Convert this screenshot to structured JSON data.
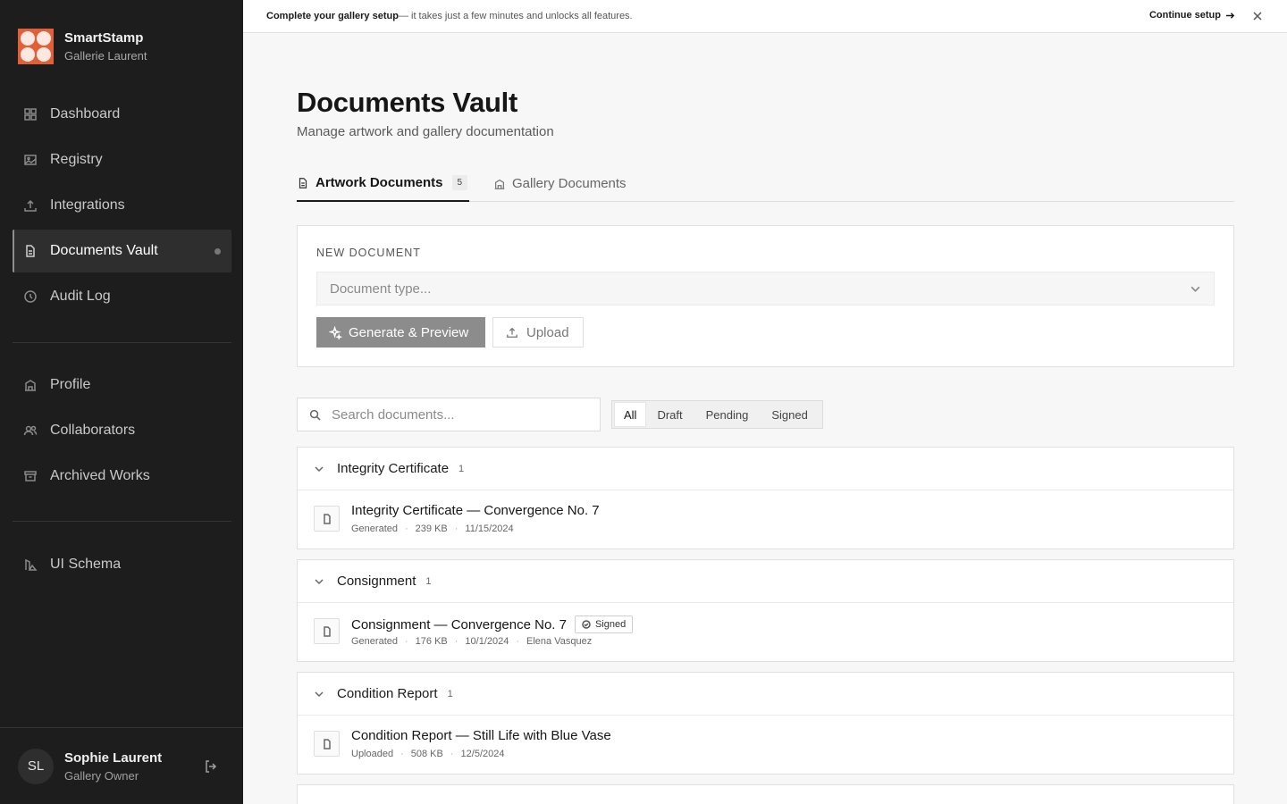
{
  "brand": {
    "name": "SmartStamp",
    "sub": "Gallerie Laurent"
  },
  "nav": [
    {
      "label": "Dashboard",
      "icon": "grid-icon"
    },
    {
      "label": "Registry",
      "icon": "image-icon"
    },
    {
      "label": "Integrations",
      "icon": "upload-icon"
    },
    {
      "label": "Documents Vault",
      "icon": "document-icon",
      "active": true
    },
    {
      "label": "Audit Log",
      "icon": "clock-icon"
    },
    {
      "label": "Profile",
      "icon": "building-icon"
    },
    {
      "label": "Collaborators",
      "icon": "users-icon"
    },
    {
      "label": "Archived Works",
      "icon": "archive-icon"
    },
    {
      "label": "UI Schema",
      "icon": "schema-icon"
    }
  ],
  "user": {
    "initials": "SL",
    "name": "Sophie Laurent",
    "role": "Gallery Owner"
  },
  "banner": {
    "bold": "Complete your gallery setup",
    "rest": " — it takes just a few minutes and unlocks all features.",
    "cta": "Continue setup"
  },
  "page": {
    "title": "Documents Vault",
    "subtitle": "Manage artwork and gallery documentation"
  },
  "tabs": [
    {
      "label": "Artwork Documents",
      "count": "5"
    },
    {
      "label": "Gallery Documents"
    }
  ],
  "new_doc": {
    "label": "NEW DOCUMENT",
    "select_placeholder": "Document type...",
    "generate_label": "Generate & Preview",
    "upload_label": "Upload"
  },
  "search": {
    "placeholder": "Search documents..."
  },
  "filters": [
    "All",
    "Draft",
    "Pending",
    "Signed"
  ],
  "groups": [
    {
      "name": "Integrity Certificate",
      "count": "1",
      "doc": {
        "title": "Integrity Certificate — Convergence No. 7",
        "source": "Generated",
        "size": "239 KB",
        "date": "11/15/2024"
      }
    },
    {
      "name": "Consignment",
      "count": "1",
      "doc": {
        "title": "Consignment — Convergence No. 7",
        "badge": "Signed",
        "source": "Generated",
        "size": "176 KB",
        "date": "10/1/2024",
        "person": "Elena Vasquez"
      }
    },
    {
      "name": "Condition Report",
      "count": "1",
      "doc": {
        "title": "Condition Report — Still Life with Blue Vase",
        "source": "Uploaded",
        "size": "508 KB",
        "date": "12/5/2024"
      }
    }
  ]
}
